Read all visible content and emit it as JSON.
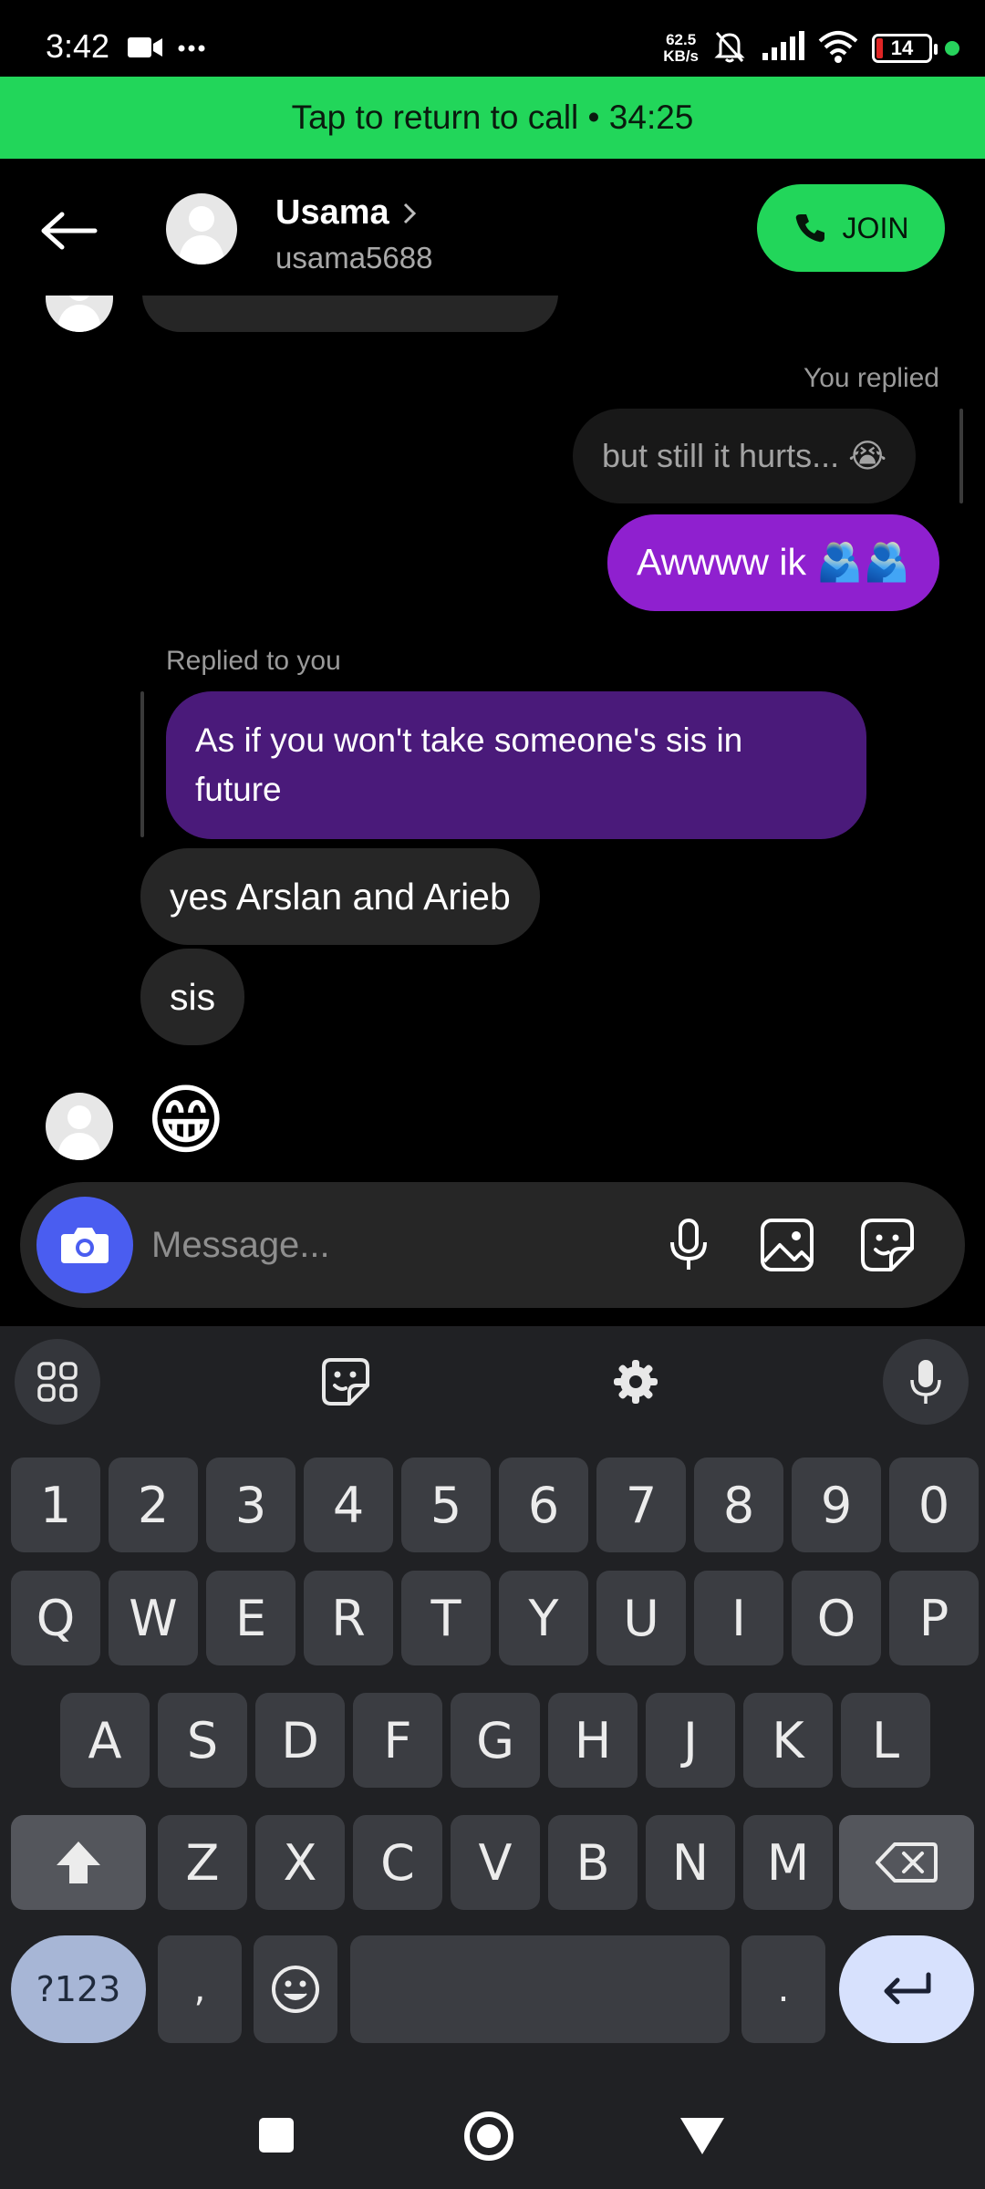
{
  "status_bar": {
    "time": "3:42",
    "net_speed_value": "62.5",
    "net_speed_unit": "KB/s",
    "battery": "14",
    "battery_level_percent": 14,
    "icons": [
      "video-camera-icon",
      "more-dots-icon",
      "bell-muted-icon",
      "signal-icon",
      "wifi-icon",
      "battery-icon",
      "privacy-indicator-dot"
    ]
  },
  "call_banner": {
    "text": "Tap to return to call • 34:25"
  },
  "header": {
    "name": "Usama",
    "username": "usama5688",
    "join_label": "JOIN"
  },
  "chat": {
    "you_replied_label": "You replied",
    "quoted_reply": "but still it hurts... 😭",
    "my_message": "Awwww ik 🫂🫂",
    "replied_to_you_label": "Replied to you",
    "quoted_my_message": "As if you won't take someone's sis in future",
    "their_messages": [
      "yes Arslan and Arieb",
      "sis"
    ],
    "emoji_message": "😁"
  },
  "composer": {
    "placeholder": "Message..."
  },
  "keyboard": {
    "number_row": [
      "1",
      "2",
      "3",
      "4",
      "5",
      "6",
      "7",
      "8",
      "9",
      "0"
    ],
    "row1": [
      "Q",
      "W",
      "E",
      "R",
      "T",
      "Y",
      "U",
      "I",
      "O",
      "P"
    ],
    "row2": [
      "A",
      "S",
      "D",
      "F",
      "G",
      "H",
      "J",
      "K",
      "L"
    ],
    "row3": [
      "Z",
      "X",
      "C",
      "V",
      "B",
      "N",
      "M"
    ],
    "symbols_key": "?123",
    "comma_key": ",",
    "period_key": "."
  },
  "colors": {
    "call_green": "#22d65a",
    "my_bubble_purple": "#8f20cf",
    "quoted_bubble_purple": "#4a1a7a",
    "camera_blue": "#4a5df0",
    "enter_key": "#d7e1fd",
    "symbols_key": "#a7b6d6"
  }
}
